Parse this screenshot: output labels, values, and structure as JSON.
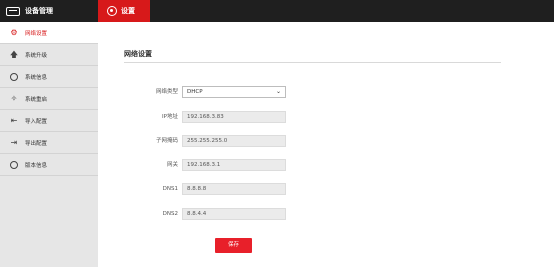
{
  "header": {
    "brand_label": "设备管理",
    "active_tab_label": "设置"
  },
  "sidebar": {
    "items": [
      {
        "label": "网络设置",
        "icon": "gear-icon",
        "active": true
      },
      {
        "label": "系统升级",
        "icon": "arrow-up-icon",
        "active": false
      },
      {
        "label": "系统信息",
        "icon": "info-icon",
        "active": false
      },
      {
        "label": "系统重启",
        "icon": "restart-icon",
        "active": false
      },
      {
        "label": "导入配置",
        "icon": "import-icon",
        "active": false
      },
      {
        "label": "导出配置",
        "icon": "export-icon",
        "active": false
      },
      {
        "label": "版本信息",
        "icon": "version-icon",
        "active": false
      }
    ]
  },
  "main": {
    "title": "网络设置",
    "fields": {
      "network_type": {
        "label": "网络类型",
        "value": "DHCP"
      },
      "ip": {
        "label": "IP地址",
        "value": "192.168.3.83"
      },
      "subnet": {
        "label": "子网掩码",
        "value": "255.255.255.0"
      },
      "gateway": {
        "label": "网关",
        "value": "192.168.3.1"
      },
      "dns1": {
        "label": "DNS1",
        "value": "8.8.8.8"
      },
      "dns2": {
        "label": "DNS2",
        "value": "8.8.4.4"
      }
    },
    "save_label": "保存"
  },
  "colors": {
    "accent": "#d7191a",
    "topbar": "#1f1f1f",
    "sidebar": "#e6e6e6"
  }
}
